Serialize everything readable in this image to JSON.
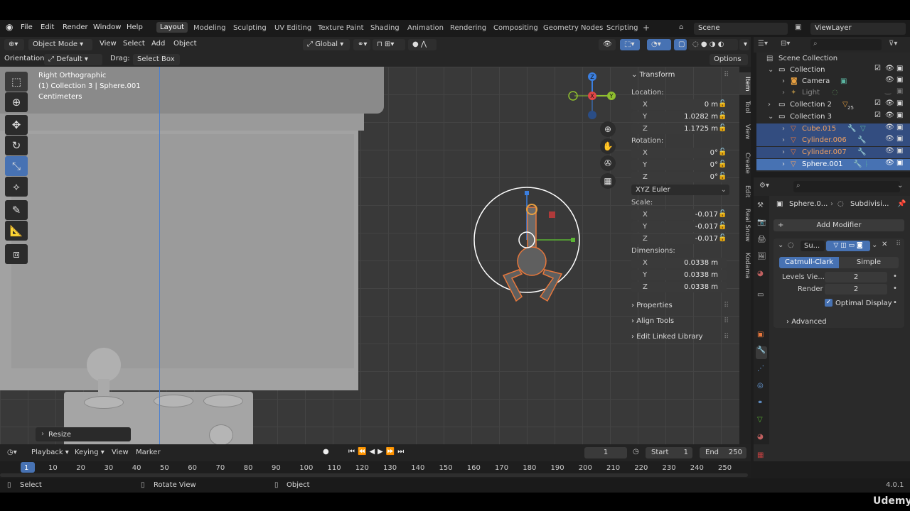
{
  "menubar": {
    "menus": [
      "File",
      "Edit",
      "Render",
      "Window",
      "Help"
    ],
    "workspaces": [
      "Layout",
      "Modeling",
      "Sculpting",
      "UV Editing",
      "Texture Paint",
      "Shading",
      "Animation",
      "Rendering",
      "Compositing",
      "Geometry Nodes",
      "Scripting"
    ],
    "active_workspace": "Layout",
    "scene": "Scene",
    "view_layer": "ViewLayer"
  },
  "viewport_header": {
    "mode": "Object Mode",
    "menus": [
      "View",
      "Select",
      "Add",
      "Object"
    ],
    "orientation_label": "Orientation:",
    "orientation_value": "Default",
    "drag_label": "Drag:",
    "drag_value": "Select Box",
    "transform_orientation": "Global",
    "options": "Options"
  },
  "viewport_info": {
    "view": "Right Orthographic",
    "collection": "(1) Collection 3 | Sphere.001",
    "units": "Centimeters"
  },
  "last_operator": "Resize",
  "gizmo_axes": {
    "z": "Z",
    "x": "X",
    "y": "Y"
  },
  "npanel": {
    "title": "Transform",
    "location_label": "Location:",
    "location": {
      "x": "0 m",
      "y": "1.0282 m",
      "z": "1.1725 m"
    },
    "rotation_label": "Rotation:",
    "rotation": {
      "x": "0°",
      "y": "0°",
      "z": "0°"
    },
    "rotation_mode": "XYZ Euler",
    "scale_label": "Scale:",
    "scale": {
      "x": "-0.017",
      "y": "-0.017",
      "z": "-0.017"
    },
    "dimensions_label": "Dimensions:",
    "dimensions": {
      "x": "0.0338 m",
      "y": "0.0338 m",
      "z": "0.0338 m"
    },
    "axis_labels": {
      "x": "X",
      "y": "Y",
      "z": "Z"
    },
    "collapsed_sections": [
      "Properties",
      "Align Tools",
      "Edit Linked Library"
    ],
    "tabs": [
      "Item",
      "Tool",
      "View",
      "Create",
      "Edit",
      "Real Snow",
      "Kodama"
    ]
  },
  "outliner": {
    "root": "Scene Collection",
    "rows": [
      {
        "name": "Collection",
        "indent": 1,
        "selected": false
      },
      {
        "name": "Camera",
        "indent": 2,
        "selected": false
      },
      {
        "name": "Light",
        "indent": 2,
        "selected": false
      },
      {
        "name": "Collection 2",
        "indent": 1,
        "selected": false
      },
      {
        "name": "Collection 3",
        "indent": 1,
        "selected": false
      },
      {
        "name": "Cube.015",
        "indent": 2,
        "selected": true
      },
      {
        "name": "Cylinder.006",
        "indent": 2,
        "selected": true
      },
      {
        "name": "Cylinder.007",
        "indent": 2,
        "selected": true
      },
      {
        "name": "Sphere.001",
        "indent": 2,
        "selected": true
      }
    ],
    "badge_count": "25"
  },
  "properties": {
    "breadcrumb_object": "Sphere.0...",
    "breadcrumb_modifier": "Subdivisi...",
    "add_modifier": "Add Modifier",
    "modifier_name": "Su...",
    "mode_catmull": "Catmull-Clark",
    "mode_simple": "Simple",
    "levels_viewport_label": "Levels Vie...",
    "levels_viewport": "2",
    "render_label": "Render",
    "render_levels": "2",
    "optimal_display": "Optimal Display",
    "advanced": "Advanced"
  },
  "timeline": {
    "menus": [
      "Playback",
      "Keying",
      "View",
      "Marker"
    ],
    "current_frame": "1",
    "start_label": "Start",
    "start": "1",
    "end_label": "End",
    "end": "250",
    "ticks": [
      "1",
      "10",
      "20",
      "30",
      "40",
      "50",
      "60",
      "70",
      "80",
      "90",
      "100",
      "110",
      "120",
      "130",
      "140",
      "150",
      "160",
      "170",
      "180",
      "190",
      "200",
      "210",
      "220",
      "230",
      "240",
      "250"
    ]
  },
  "statusbar": {
    "select": "Select",
    "rotate_view": "Rotate View",
    "object": "Object",
    "version": "4.0.1"
  },
  "watermark": "Udemy",
  "colors": {
    "accent": "#4772b3",
    "selected_orange": "#e8783c",
    "selection_row": "#334d80"
  }
}
